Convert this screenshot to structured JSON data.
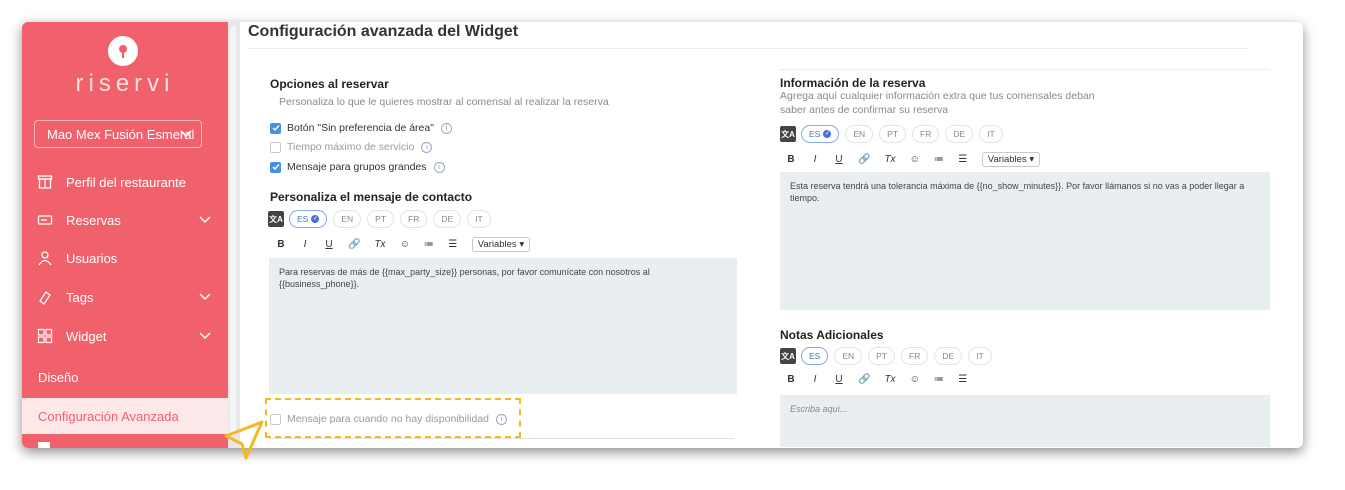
{
  "sidebar": {
    "logo_text": "riservi",
    "restaurant": "Mao Mex Fusión Esmeral",
    "items": [
      {
        "label": "Perfil del restaurante",
        "icon": "storefront-icon"
      },
      {
        "label": "Reservas",
        "icon": "ticket-icon"
      },
      {
        "label": "Usuarios",
        "icon": "user-icon"
      },
      {
        "label": "Tags",
        "icon": "tag-icon"
      },
      {
        "label": "Widget",
        "icon": "widget-grid-icon"
      }
    ],
    "sub_design": "Diseño",
    "sub_advanced": "Configuración Avanzada",
    "accent": "#f0616b"
  },
  "main": {
    "title": "Configuración avanzada del Widget",
    "booking_options": {
      "title": "Opciones al reservar",
      "subtitle": "Personaliza lo que le quieres mostrar al comensal al realizar la reserva",
      "checkboxes": [
        {
          "label": "Botón \"Sin preferencia de área\"",
          "checked": true
        },
        {
          "label": "Tiempo máximo de servicio",
          "checked": false
        },
        {
          "label": "Mensaje para grupos grandes",
          "checked": true
        }
      ]
    },
    "contact": {
      "title": "Personaliza el mensaje de contacto",
      "languages": [
        "ES",
        "EN",
        "PT",
        "FR",
        "DE",
        "IT"
      ],
      "toolbar": [
        "B",
        "I",
        "U",
        "🔗",
        "Tx",
        "☺",
        "≔",
        "☰"
      ],
      "variables_label": "Variables",
      "text": "Para reservas de más de {{max_party_size}} personas, por favor comunícate con nosotros al {{business_phone}}."
    },
    "no_availability": {
      "label": "Mensaje para cuando no hay disponibilidad",
      "checked": false
    },
    "reservation_info": {
      "title": "Información de la reserva",
      "subtitle_1": "Agrega aquí cualquier información extra que tus comensales deban",
      "subtitle_2": "saber antes de confirmar su reserva",
      "languages": [
        "ES",
        "EN",
        "PT",
        "FR",
        "DE",
        "IT"
      ],
      "variables_label": "Variables",
      "text": "Esta reserva tendrá una tolerancia máxima de {{no_show_minutes}}. Por favor llámanos si no vas a poder llegar a tiempo."
    },
    "notes": {
      "title": "Notas Adicionales",
      "languages": [
        "ES",
        "EN",
        "PT",
        "FR",
        "DE",
        "IT"
      ],
      "placeholder": "Escriba aquí..."
    }
  },
  "highlight_color": "#f5b821"
}
